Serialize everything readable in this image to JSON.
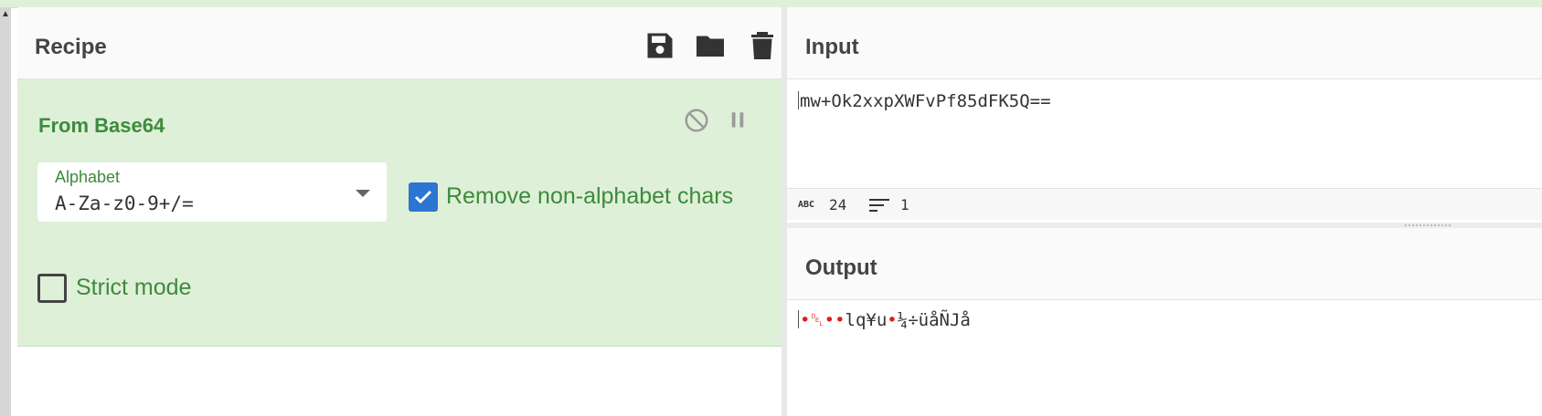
{
  "recipe": {
    "title": "Recipe",
    "icons": [
      "save-icon",
      "folder-icon",
      "trash-icon"
    ]
  },
  "operation": {
    "name": "From Base64",
    "alphabet": {
      "label": "Alphabet",
      "value": "A-Za-z0-9+/="
    },
    "remove_non_alphabet": {
      "label": "Remove non-alphabet chars",
      "checked": true
    },
    "strict_mode": {
      "label": "Strict mode",
      "checked": false
    }
  },
  "input": {
    "title": "Input",
    "text": "mw+Ok2xxpXWFvPf85dFK5Q==",
    "length": "24",
    "lines": "1"
  },
  "output": {
    "title": "Output",
    "prefix_glyphs": "•␡••",
    "text_a": "lq¥u",
    "glyph_mid": "•",
    "text_b": "¼÷üåÑJå"
  },
  "colors": {
    "accent_green": "#3c8b3c",
    "card_bg": "#dff0d8",
    "checkbox_blue": "#2c75d0"
  }
}
